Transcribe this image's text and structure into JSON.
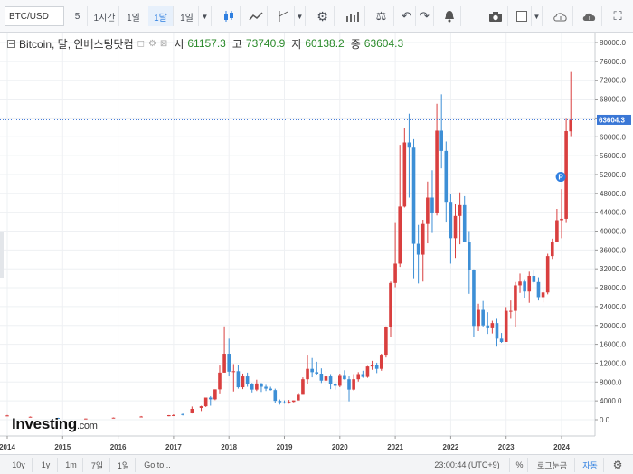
{
  "toolbar": {
    "symbol": "BTC/USD",
    "intervals": [
      "5",
      "1시간",
      "1일",
      "1달",
      "1일"
    ],
    "active_interval_index": 3
  },
  "legend": {
    "title": "Bitcoin, 달, 인베스팅닷컴",
    "open_label": "시",
    "open_value": "61157.3",
    "high_label": "고",
    "high_value": "73740.9",
    "low_label": "저",
    "low_value": "60138.2",
    "close_label": "종",
    "close_value": "63604.3"
  },
  "logo": {
    "main": "Investing",
    "suffix": ".com"
  },
  "bottom_bar": {
    "ranges": [
      "10y",
      "1y",
      "1m",
      "7일",
      "1일",
      "Go to..."
    ],
    "time": "23:00:44 (UTC+9)",
    "percent": "%",
    "log": "로그눈금",
    "auto": "자동"
  },
  "chart_data": {
    "type": "candlestick",
    "symbol": "BTC/USD",
    "x_axis_labels": [
      "2014",
      "2015",
      "2016",
      "2017",
      "2018",
      "2019",
      "2020",
      "2021",
      "2022",
      "2023",
      "2024"
    ],
    "y_axis_labels": [
      "0.0",
      "4000.0",
      "8000.0",
      "12000.0",
      "16000.0",
      "20000.0",
      "24000.0",
      "28000.0",
      "32000.0",
      "36000.0",
      "40000.0",
      "44000.0",
      "48000.0",
      "52000.0",
      "56000.0",
      "60000.0",
      "64000.0",
      "68000.0",
      "72000.0",
      "76000.0",
      "80000.0"
    ],
    "ylim": [
      0,
      80000
    ],
    "last_price": "63604.3",
    "last_price_value": 63604.3,
    "up_color": "#d93f3f",
    "down_color": "#3d8fd6",
    "event_marker": "P",
    "event_marker_date": "2024-02",
    "event_marker_value": 51500,
    "candles": [
      {
        "d": "2014-01",
        "o": 800,
        "h": 1000,
        "l": 750,
        "c": 900
      },
      {
        "d": "2014-06",
        "o": 600,
        "h": 680,
        "l": 550,
        "c": 620
      },
      {
        "d": "2014-12",
        "o": 380,
        "h": 420,
        "l": 300,
        "c": 320
      },
      {
        "d": "2015-06",
        "o": 230,
        "h": 270,
        "l": 220,
        "c": 250
      },
      {
        "d": "2015-12",
        "o": 380,
        "h": 470,
        "l": 350,
        "c": 430
      },
      {
        "d": "2016-06",
        "o": 540,
        "h": 780,
        "l": 520,
        "c": 670
      },
      {
        "d": "2016-12",
        "o": 740,
        "h": 980,
        "l": 730,
        "c": 960
      },
      {
        "d": "2017-01",
        "o": 960,
        "h": 1150,
        "l": 760,
        "c": 970
      },
      {
        "d": "2017-03",
        "o": 1190,
        "h": 1300,
        "l": 890,
        "c": 1080
      },
      {
        "d": "2017-05",
        "o": 1350,
        "h": 2800,
        "l": 1320,
        "c": 2300
      },
      {
        "d": "2017-07",
        "o": 2500,
        "h": 2950,
        "l": 1850,
        "c": 2860
      },
      {
        "d": "2017-08",
        "o": 2860,
        "h": 4700,
        "l": 2700,
        "c": 4700
      },
      {
        "d": "2017-09",
        "o": 4700,
        "h": 5000,
        "l": 2970,
        "c": 4340
      },
      {
        "d": "2017-10",
        "o": 4340,
        "h": 6450,
        "l": 4160,
        "c": 6450
      },
      {
        "d": "2017-11",
        "o": 6450,
        "h": 11500,
        "l": 5400,
        "c": 10000
      },
      {
        "d": "2017-12",
        "o": 10000,
        "h": 19800,
        "l": 10000,
        "c": 14000
      },
      {
        "d": "2018-01",
        "o": 14000,
        "h": 17200,
        "l": 9200,
        "c": 10200
      },
      {
        "d": "2018-02",
        "o": 10200,
        "h": 11800,
        "l": 6000,
        "c": 10300
      },
      {
        "d": "2018-03",
        "o": 10300,
        "h": 11700,
        "l": 6600,
        "c": 6900
      },
      {
        "d": "2018-04",
        "o": 6900,
        "h": 9800,
        "l": 6500,
        "c": 9200
      },
      {
        "d": "2018-05",
        "o": 9200,
        "h": 10000,
        "l": 7000,
        "c": 7500
      },
      {
        "d": "2018-06",
        "o": 7500,
        "h": 7800,
        "l": 5800,
        "c": 6400
      },
      {
        "d": "2018-07",
        "o": 6400,
        "h": 8500,
        "l": 6100,
        "c": 7700
      },
      {
        "d": "2018-08",
        "o": 7700,
        "h": 7800,
        "l": 5900,
        "c": 7000
      },
      {
        "d": "2018-09",
        "o": 7000,
        "h": 7400,
        "l": 6100,
        "c": 6600
      },
      {
        "d": "2018-10",
        "o": 6600,
        "h": 7000,
        "l": 6200,
        "c": 6300
      },
      {
        "d": "2018-11",
        "o": 6300,
        "h": 6600,
        "l": 3500,
        "c": 4000
      },
      {
        "d": "2018-12",
        "o": 4000,
        "h": 4300,
        "l": 3200,
        "c": 3700
      },
      {
        "d": "2019-01",
        "o": 3700,
        "h": 4100,
        "l": 3400,
        "c": 3450
      },
      {
        "d": "2019-02",
        "o": 3450,
        "h": 4200,
        "l": 3400,
        "c": 3800
      },
      {
        "d": "2019-03",
        "o": 3800,
        "h": 4100,
        "l": 3700,
        "c": 4100
      },
      {
        "d": "2019-04",
        "o": 4100,
        "h": 5600,
        "l": 4100,
        "c": 5300
      },
      {
        "d": "2019-05",
        "o": 5300,
        "h": 9000,
        "l": 5300,
        "c": 8600
      },
      {
        "d": "2019-06",
        "o": 8600,
        "h": 13800,
        "l": 7500,
        "c": 10800
      },
      {
        "d": "2019-07",
        "o": 10800,
        "h": 13100,
        "l": 9000,
        "c": 10100
      },
      {
        "d": "2019-08",
        "o": 10100,
        "h": 12300,
        "l": 9400,
        "c": 9600
      },
      {
        "d": "2019-09",
        "o": 9600,
        "h": 10900,
        "l": 7800,
        "c": 8300
      },
      {
        "d": "2019-10",
        "o": 8300,
        "h": 10400,
        "l": 7300,
        "c": 9200
      },
      {
        "d": "2019-11",
        "o": 9200,
        "h": 9500,
        "l": 6500,
        "c": 7600
      },
      {
        "d": "2019-12",
        "o": 7600,
        "h": 7800,
        "l": 6400,
        "c": 7200
      },
      {
        "d": "2020-01",
        "o": 7200,
        "h": 9600,
        "l": 6900,
        "c": 9300
      },
      {
        "d": "2020-02",
        "o": 9300,
        "h": 10500,
        "l": 8500,
        "c": 8600
      },
      {
        "d": "2020-03",
        "o": 8600,
        "h": 9200,
        "l": 3900,
        "c": 6400
      },
      {
        "d": "2020-04",
        "o": 6400,
        "h": 9500,
        "l": 6200,
        "c": 8600
      },
      {
        "d": "2020-05",
        "o": 8600,
        "h": 10100,
        "l": 8100,
        "c": 9500
      },
      {
        "d": "2020-06",
        "o": 9500,
        "h": 10400,
        "l": 8900,
        "c": 9100
      },
      {
        "d": "2020-07",
        "o": 9100,
        "h": 11400,
        "l": 8900,
        "c": 11300
      },
      {
        "d": "2020-08",
        "o": 11300,
        "h": 12500,
        "l": 10600,
        "c": 11600
      },
      {
        "d": "2020-09",
        "o": 11600,
        "h": 12100,
        "l": 9900,
        "c": 10800
      },
      {
        "d": "2020-10",
        "o": 10800,
        "h": 14000,
        "l": 10400,
        "c": 13800
      },
      {
        "d": "2020-11",
        "o": 13800,
        "h": 19800,
        "l": 13200,
        "c": 19700
      },
      {
        "d": "2020-12",
        "o": 19700,
        "h": 29300,
        "l": 17600,
        "c": 29000
      },
      {
        "d": "2021-01",
        "o": 29000,
        "h": 41900,
        "l": 28100,
        "c": 33100
      },
      {
        "d": "2021-02",
        "o": 33100,
        "h": 58300,
        "l": 32400,
        "c": 45200
      },
      {
        "d": "2021-03",
        "o": 45200,
        "h": 61800,
        "l": 45000,
        "c": 58800
      },
      {
        "d": "2021-04",
        "o": 58800,
        "h": 64900,
        "l": 47100,
        "c": 57700
      },
      {
        "d": "2021-05",
        "o": 57700,
        "h": 59500,
        "l": 30000,
        "c": 37300
      },
      {
        "d": "2021-06",
        "o": 37300,
        "h": 41300,
        "l": 28900,
        "c": 35000
      },
      {
        "d": "2021-07",
        "o": 35000,
        "h": 42400,
        "l": 29300,
        "c": 41500
      },
      {
        "d": "2021-08",
        "o": 41500,
        "h": 50500,
        "l": 37400,
        "c": 47100
      },
      {
        "d": "2021-09",
        "o": 47100,
        "h": 52900,
        "l": 39600,
        "c": 43800
      },
      {
        "d": "2021-10",
        "o": 43800,
        "h": 67000,
        "l": 43300,
        "c": 61300
      },
      {
        "d": "2021-11",
        "o": 61300,
        "h": 69000,
        "l": 53300,
        "c": 57000
      },
      {
        "d": "2021-12",
        "o": 57000,
        "h": 59000,
        "l": 42000,
        "c": 46200
      },
      {
        "d": "2022-01",
        "o": 46200,
        "h": 47900,
        "l": 33100,
        "c": 38500
      },
      {
        "d": "2022-02",
        "o": 38500,
        "h": 45800,
        "l": 34300,
        "c": 43200
      },
      {
        "d": "2022-03",
        "o": 43200,
        "h": 48200,
        "l": 37200,
        "c": 45500
      },
      {
        "d": "2022-04",
        "o": 45500,
        "h": 47400,
        "l": 37600,
        "c": 37700
      },
      {
        "d": "2022-05",
        "o": 37700,
        "h": 40000,
        "l": 26700,
        "c": 31800
      },
      {
        "d": "2022-06",
        "o": 31800,
        "h": 31900,
        "l": 17600,
        "c": 19900
      },
      {
        "d": "2022-07",
        "o": 19900,
        "h": 24600,
        "l": 18800,
        "c": 23300
      },
      {
        "d": "2022-08",
        "o": 23300,
        "h": 25200,
        "l": 19600,
        "c": 20000
      },
      {
        "d": "2022-09",
        "o": 20000,
        "h": 22800,
        "l": 18200,
        "c": 19400
      },
      {
        "d": "2022-10",
        "o": 19400,
        "h": 21000,
        "l": 18300,
        "c": 20500
      },
      {
        "d": "2022-11",
        "o": 20500,
        "h": 21400,
        "l": 15500,
        "c": 17200
      },
      {
        "d": "2022-12",
        "o": 17200,
        "h": 18400,
        "l": 16300,
        "c": 16500
      },
      {
        "d": "2023-01",
        "o": 16500,
        "h": 23900,
        "l": 16500,
        "c": 23100
      },
      {
        "d": "2023-02",
        "o": 23100,
        "h": 25300,
        "l": 21400,
        "c": 23100
      },
      {
        "d": "2023-03",
        "o": 23100,
        "h": 29200,
        "l": 19600,
        "c": 28500
      },
      {
        "d": "2023-04",
        "o": 28500,
        "h": 31000,
        "l": 26900,
        "c": 29300
      },
      {
        "d": "2023-05",
        "o": 29300,
        "h": 29800,
        "l": 25900,
        "c": 27200
      },
      {
        "d": "2023-06",
        "o": 27200,
        "h": 31400,
        "l": 24800,
        "c": 30500
      },
      {
        "d": "2023-07",
        "o": 30500,
        "h": 31800,
        "l": 28900,
        "c": 29200
      },
      {
        "d": "2023-08",
        "o": 29200,
        "h": 30200,
        "l": 25300,
        "c": 26000
      },
      {
        "d": "2023-09",
        "o": 26000,
        "h": 27500,
        "l": 24900,
        "c": 27000
      },
      {
        "d": "2023-10",
        "o": 27000,
        "h": 35200,
        "l": 26600,
        "c": 34700
      },
      {
        "d": "2023-11",
        "o": 34700,
        "h": 38400,
        "l": 34100,
        "c": 37700
      },
      {
        "d": "2023-12",
        "o": 37700,
        "h": 44700,
        "l": 37600,
        "c": 42300
      },
      {
        "d": "2024-01",
        "o": 42300,
        "h": 48900,
        "l": 38500,
        "c": 42600
      },
      {
        "d": "2024-02",
        "o": 42600,
        "h": 64000,
        "l": 41900,
        "c": 61200
      },
      {
        "d": "2024-03",
        "o": 61157.3,
        "h": 73740.9,
        "l": 60138.2,
        "c": 63604.3
      }
    ]
  }
}
